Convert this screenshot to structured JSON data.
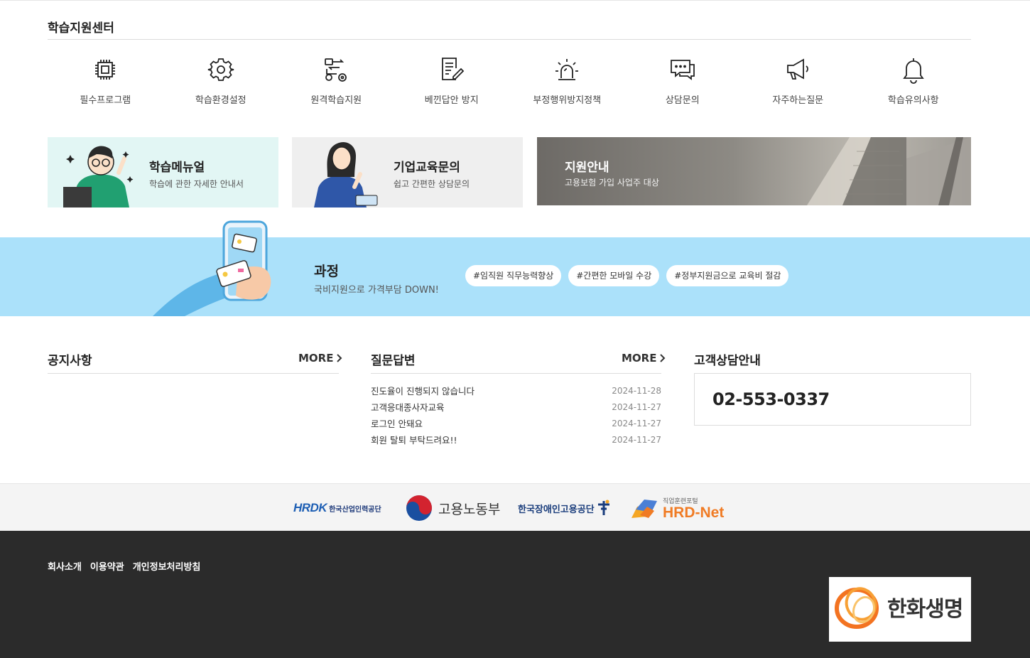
{
  "support": {
    "title": "학습지원센터",
    "items": [
      {
        "label": "필수프로그램",
        "icon": "cpu-icon"
      },
      {
        "label": "학습환경설정",
        "icon": "gear-icon"
      },
      {
        "label": "원격학습지원",
        "icon": "remote-connect-icon"
      },
      {
        "label": "베낀답안 방지",
        "icon": "document-pen-icon"
      },
      {
        "label": "부정행위방지정책",
        "icon": "alarm-light-icon"
      },
      {
        "label": "상담문의",
        "icon": "chat-bubbles-icon"
      },
      {
        "label": "자주하는질문",
        "icon": "megaphone-icon"
      },
      {
        "label": "학습유의사항",
        "icon": "bell-icon"
      }
    ]
  },
  "cards": [
    {
      "title": "학습메뉴얼",
      "sub": "학습에 관한 자세한 안내서"
    },
    {
      "title": "기업교육문의",
      "sub": "쉽고 간편한 상담문의"
    },
    {
      "title": "지원안내",
      "sub": "고용보험 가입 사업주 대상"
    }
  ],
  "banner": {
    "title": "과정",
    "sub": "국비지원으로 가격부담 DOWN!",
    "tags": [
      "#임직원 직무능력향상",
      "#간편한 모바일 수강",
      "#정부지원금으로 교육비 절감"
    ]
  },
  "notice": {
    "title": "공지사항",
    "more": "MORE"
  },
  "qa": {
    "title": "질문답변",
    "more": "MORE",
    "items": [
      {
        "text": "진도율이 진행되지 않습니다",
        "date": "2024-11-28"
      },
      {
        "text": "고객응대종사자교육",
        "date": "2024-11-27"
      },
      {
        "text": "로그인 안돼요",
        "date": "2024-11-27"
      },
      {
        "text": "회원 탈퇴 부탁드려요!!",
        "date": "2024-11-27"
      }
    ]
  },
  "contact": {
    "title": "고객상담안내",
    "phone": "02-553-0337"
  },
  "partners": {
    "hrdk": {
      "mark": "HRDK",
      "name": "한국산업인력공단"
    },
    "moel": {
      "name": "고용노동부"
    },
    "kead": {
      "name": "한국장애인고용공단"
    },
    "hrdnet": {
      "small": "직업훈련포털",
      "name": "HRD-Net"
    }
  },
  "footer": {
    "links": [
      "회사소개",
      "이용약관",
      "개인정보처리방침"
    ],
    "logo_text": "한화생명"
  },
  "colors": {
    "banner_bg": "#abe1fa",
    "card_mint": "#e2f6f4",
    "card_gray": "#efefef",
    "footer_bg": "#2b2b2b",
    "hanwha_orange": "#f37321",
    "hrdk_blue": "#1e5fb4"
  }
}
